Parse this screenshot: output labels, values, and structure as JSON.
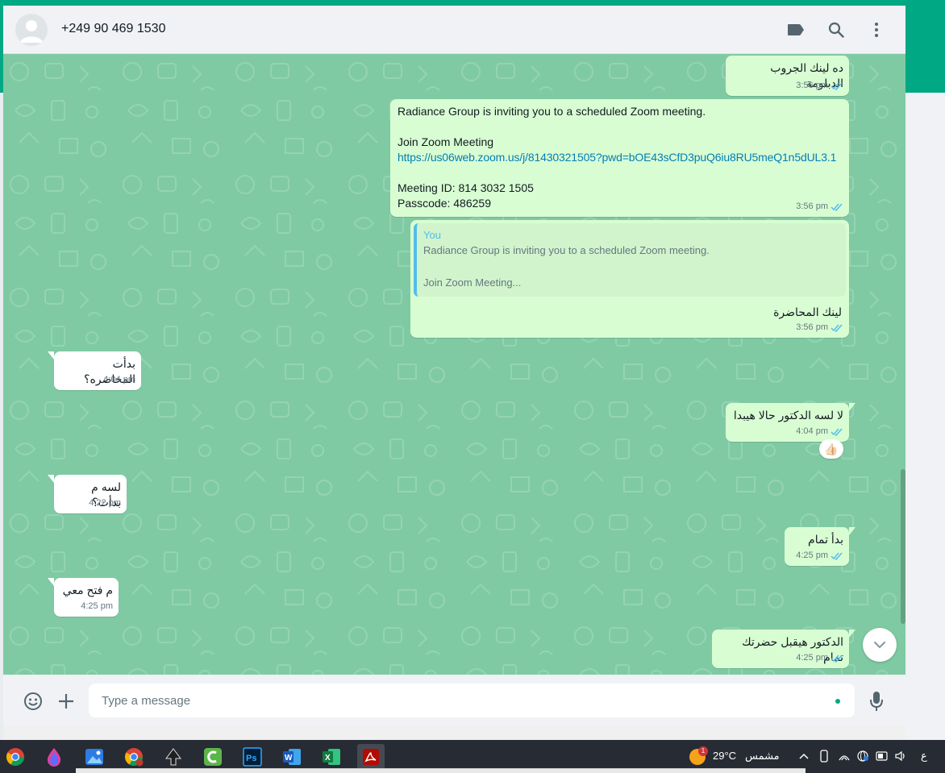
{
  "colors": {
    "accent": "#00a884",
    "outgoing_bubble": "#d9fdd3",
    "incoming_bubble": "#ffffff",
    "chat_background": "#7fcaa3",
    "read_ticks": "#53bdeb",
    "link": "#027eb5"
  },
  "header": {
    "contact_name": "+249 90 469 1530",
    "icons": [
      "label-icon",
      "search-icon",
      "menu-icon"
    ]
  },
  "messages": [
    {
      "direction": "out",
      "text": "ده لينك الجروب الدبلومة",
      "time": "3:56 pm",
      "status": "read"
    },
    {
      "direction": "out",
      "line1": "Radiance Group is inviting you to a scheduled Zoom meeting.",
      "line2": "Join Zoom Meeting",
      "link": "https://us06web.zoom.us/j/81430321505?pwd=bOE43sCfD3puQ6iu8RU5meQ1n5dUL3.1",
      "line3": "Meeting ID: 814 3032 1505",
      "line4": "Passcode: 486259",
      "time": "3:56 pm",
      "status": "read"
    },
    {
      "direction": "out",
      "quote_author": "You",
      "quote_line1": "Radiance Group is inviting you to a scheduled Zoom meeting.",
      "quote_line2": "Join Zoom Meeting...",
      "text": "لينك المحاضرة",
      "time": "3:56 pm",
      "status": "read"
    },
    {
      "direction": "in",
      "text": "بدأت المحاضره؟",
      "time": "4:04 pm"
    },
    {
      "direction": "out",
      "text": "لا لسه الدكتور حالا هيبدا",
      "time": "4:04 pm",
      "status": "read",
      "reaction": "👍🏻"
    },
    {
      "direction": "in",
      "text": "لسه م بدأت؟",
      "time": "4:22 pm"
    },
    {
      "direction": "out",
      "text": "بدأ تمام",
      "time": "4:25 pm",
      "status": "read"
    },
    {
      "direction": "in",
      "text": "م فتح معي",
      "time": "4:25 pm"
    },
    {
      "direction": "out",
      "text": "الدكتور هيقبل حضرتك تمام",
      "time": "4:25 pm",
      "status": "read"
    }
  ],
  "composer": {
    "placeholder": "Type a message",
    "icons": [
      "emoji-icon",
      "attach-plus-icon",
      "microphone-icon"
    ]
  },
  "taskbar": {
    "apps": [
      "chrome",
      "paint-drop",
      "photos",
      "chrome-profile",
      "inkscape",
      "camtasia",
      "photoshop",
      "word",
      "excel",
      "acrobat"
    ],
    "active_app": "acrobat",
    "weather_temp": "29°C",
    "weather_desc": "مشمس",
    "weather_badge": "1",
    "language": "ع"
  }
}
